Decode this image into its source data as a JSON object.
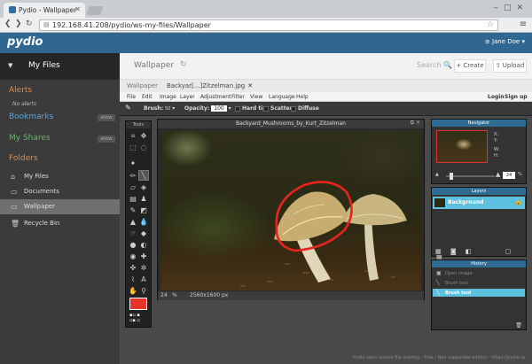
{
  "browser": {
    "tab_title": "Pydio - Wallpaper",
    "url": "192.168.41.208/pydio/ws-my-files/Wallpaper"
  },
  "app": {
    "logo": "pydio",
    "user": "Jane Doe"
  },
  "sidebar": {
    "workspace": "My Files",
    "alerts_title": "Alerts",
    "no_alerts": "No alerts",
    "bookmarks_title": "Bookmarks",
    "shares_title": "My Shares",
    "show_label": "show",
    "folders_title": "Folders",
    "folders": [
      {
        "label": "My Files",
        "icon": "home-icon"
      },
      {
        "label": "Documents",
        "icon": "folder-icon"
      },
      {
        "label": "Wallpaper",
        "icon": "folder-icon"
      },
      {
        "label": "Recycle Bin",
        "icon": "trash-icon"
      }
    ]
  },
  "toolbar": {
    "title": "Wallpaper",
    "search": "Search",
    "create": "Create",
    "upload": "Upload"
  },
  "editor_tabs": {
    "tab1": "Wallpaper",
    "tab2": "Backyar[...]Zitzelman.jpg"
  },
  "pixlr_menu": {
    "items": [
      "File",
      "Edit",
      "Image",
      "Layer",
      "Adjustment",
      "Filter",
      "View",
      "Language",
      "Help"
    ],
    "login": "Login",
    "signup": "Sign up"
  },
  "options": {
    "brush_label": "Brush:",
    "brush_size": "50",
    "opacity_label": "Opacity:",
    "opacity_value": "100",
    "hard_tip": "Hard tip",
    "scatter": "Scatter",
    "diffuse": "Diffuse"
  },
  "tools": {
    "title": "Tools"
  },
  "canvas": {
    "title": "Backyard_Mushrooms_by_Kurt_Zitzelman",
    "zoom": "24",
    "zoom_unit": "%",
    "dimensions": "2560x1600 px"
  },
  "navigator": {
    "title": "Navigator",
    "x": "X:",
    "y": "Y:",
    "w": "W:",
    "h": "H:",
    "zoom": "24",
    "unit": "%"
  },
  "layers": {
    "title": "Layers",
    "items": [
      {
        "name": "Background"
      }
    ]
  },
  "history": {
    "title": "History",
    "items": [
      {
        "label": "Open image",
        "active": false
      },
      {
        "label": "Brush tool",
        "active": false
      },
      {
        "label": "Brush tool",
        "active": true
      }
    ]
  },
  "footer": "Pydio open source file sharing - Free / Non supported edition - https://pydio.io",
  "colors": {
    "header": "#2f6790",
    "foreground": "#e83328",
    "selection": "#5cc0df",
    "annotation": "#e8241c"
  }
}
